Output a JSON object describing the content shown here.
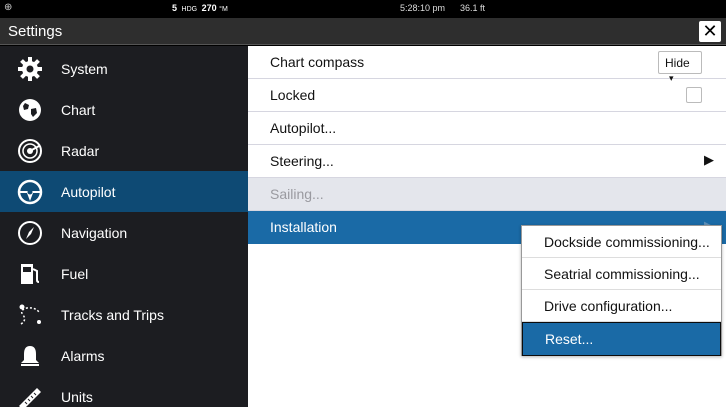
{
  "status_bar": {
    "heading_value": "5",
    "heading_label": "HDG",
    "heading_degrees": "270",
    "heading_unit": "°M",
    "time": "5:28:10 pm",
    "depth": "36.1 ft"
  },
  "title_bar": {
    "title": "Settings",
    "close_label": "✕"
  },
  "sidebar": {
    "items": [
      {
        "label": "System",
        "icon": "gear-icon"
      },
      {
        "label": "Chart",
        "icon": "globe-icon"
      },
      {
        "label": "Radar",
        "icon": "radar-icon"
      },
      {
        "label": "Autopilot",
        "icon": "steering-wheel-icon",
        "selected": true
      },
      {
        "label": "Navigation",
        "icon": "compass-icon"
      },
      {
        "label": "Fuel",
        "icon": "fuel-pump-icon"
      },
      {
        "label": "Tracks and Trips",
        "icon": "tracks-icon"
      },
      {
        "label": "Alarms",
        "icon": "bell-icon"
      },
      {
        "label": "Units",
        "icon": "ruler-icon"
      }
    ]
  },
  "main": {
    "rows": [
      {
        "label": "Chart compass",
        "control": "dropdown",
        "value": "Hide"
      },
      {
        "label": "Locked",
        "control": "checkbox",
        "checked": false
      },
      {
        "label": "Autopilot..."
      },
      {
        "label": "Steering...",
        "chevron": "▶"
      },
      {
        "label": "Sailing...",
        "disabled": true
      },
      {
        "label": "Installation",
        "chevron": "▶",
        "selected": true
      }
    ],
    "dropdown_arrow": "▾"
  },
  "submenu": {
    "items": [
      {
        "label": "Dockside commissioning..."
      },
      {
        "label": "Seatrial commissioning..."
      },
      {
        "label": "Drive configuration..."
      },
      {
        "label": "Reset...",
        "selected": true
      }
    ]
  },
  "colors": {
    "selected_blue": "#1a6aa6",
    "sidebar_selected": "#0e4a74",
    "sidebar_bg": "#1c1d21"
  }
}
